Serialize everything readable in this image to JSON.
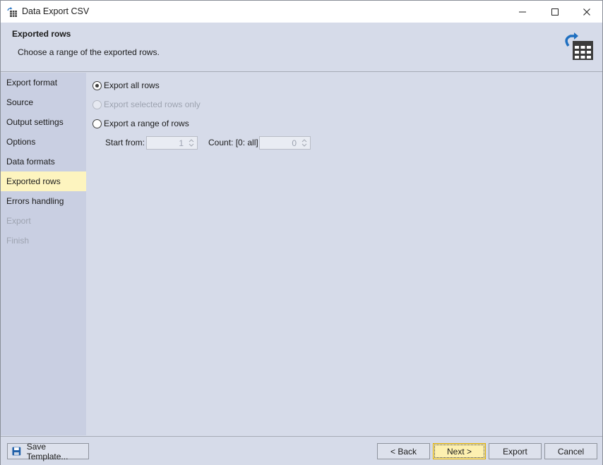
{
  "window": {
    "title": "Data Export CSV"
  },
  "header": {
    "title": "Exported rows",
    "description": "Choose a range of the exported rows."
  },
  "sidebar": {
    "items": [
      {
        "label": "Export format",
        "state": "normal"
      },
      {
        "label": "Source",
        "state": "normal"
      },
      {
        "label": "Output settings",
        "state": "normal"
      },
      {
        "label": "Options",
        "state": "normal"
      },
      {
        "label": "Data formats",
        "state": "normal"
      },
      {
        "label": "Exported rows",
        "state": "active"
      },
      {
        "label": "Errors handling",
        "state": "normal"
      },
      {
        "label": "Export",
        "state": "disabled"
      },
      {
        "label": "Finish",
        "state": "disabled"
      }
    ]
  },
  "options": {
    "export_all": {
      "label": "Export all rows",
      "checked": true
    },
    "export_selected": {
      "label": "Export selected rows only",
      "enabled": false
    },
    "export_range": {
      "label": "Export a range of rows",
      "checked": false
    },
    "start_from": {
      "label": "Start from:",
      "value": "1"
    },
    "count": {
      "label": "Count: [0: all]",
      "value": "0"
    }
  },
  "footer": {
    "save_template": "Save Template...",
    "back": "< Back",
    "next": "Next >",
    "export": "Export",
    "cancel": "Cancel"
  },
  "colors": {
    "active_item": "#fdf4bf",
    "primary_button": "#fdf0b0",
    "panel": "#d6dbe9",
    "sidebar": "#c9cfe2",
    "icon_blue": "#1f6fc0"
  }
}
